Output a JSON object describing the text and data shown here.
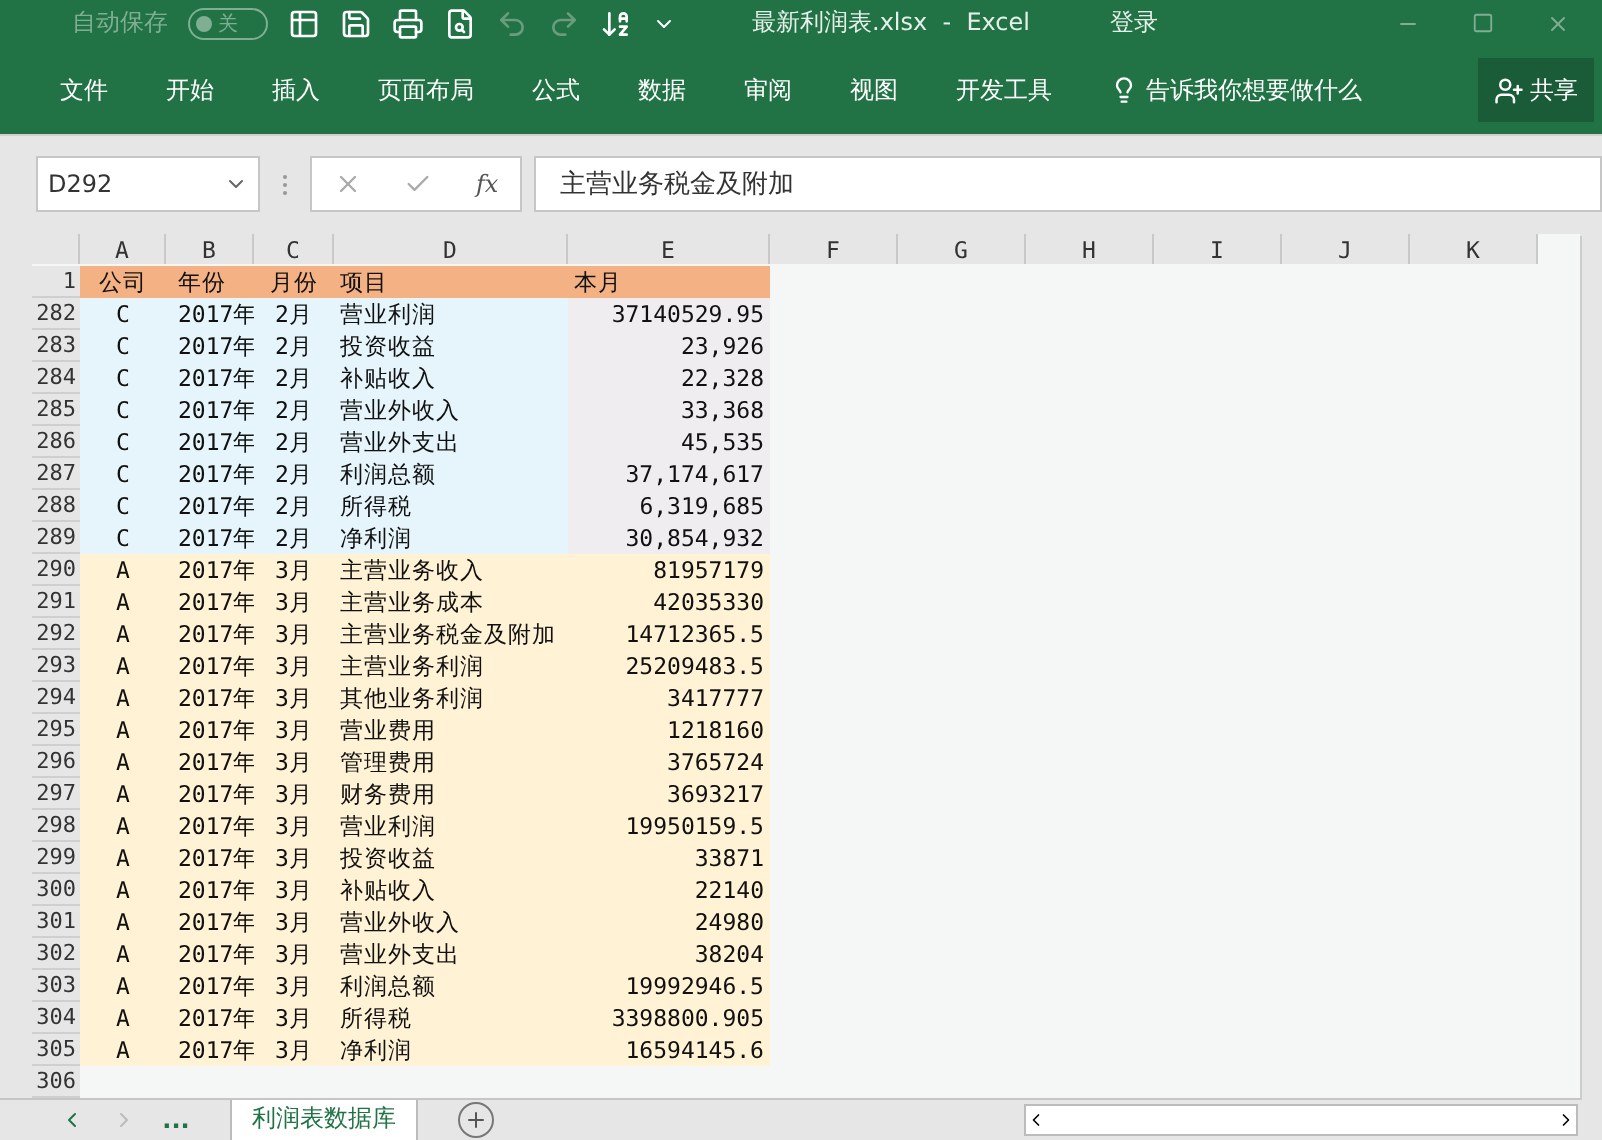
{
  "title_bar": {
    "autosave": {
      "label": "自动保存",
      "on": false,
      "state_text": "关"
    },
    "file_title": "最新利润表.xlsx  -  Excel",
    "sign_in": "登录"
  },
  "ribbon_tabs": [
    "文件",
    "开始",
    "插入",
    "页面布局",
    "公式",
    "数据",
    "审阅",
    "视图",
    "开发工具"
  ],
  "tell_me": "告诉我你想要做什么",
  "share": "共享",
  "formula_bar": {
    "name_box": "D292",
    "fx": "fx",
    "content": "主营业务税金及附加"
  },
  "columns": [
    "A",
    "B",
    "C",
    "D",
    "E",
    "F",
    "G",
    "H",
    "I",
    "J",
    "K"
  ],
  "header_row": {
    "number": "1",
    "cells": [
      "公司",
      "年份",
      "月份",
      "项目",
      "本月"
    ]
  },
  "rows": [
    {
      "number": "282",
      "kind": "blue",
      "cells": [
        "C",
        "2017年",
        "2月",
        "营业利润",
        "37140529.95"
      ]
    },
    {
      "number": "283",
      "kind": "blue",
      "cells": [
        "C",
        "2017年",
        "2月",
        "投资收益",
        "23,926"
      ]
    },
    {
      "number": "284",
      "kind": "blue",
      "cells": [
        "C",
        "2017年",
        "2月",
        "补贴收入",
        "22,328"
      ]
    },
    {
      "number": "285",
      "kind": "blue",
      "cells": [
        "C",
        "2017年",
        "2月",
        "营业外收入",
        "33,368"
      ]
    },
    {
      "number": "286",
      "kind": "blue",
      "cells": [
        "C",
        "2017年",
        "2月",
        "营业外支出",
        "45,535"
      ]
    },
    {
      "number": "287",
      "kind": "blue",
      "cells": [
        "C",
        "2017年",
        "2月",
        "利润总额",
        "37,174,617"
      ]
    },
    {
      "number": "288",
      "kind": "blue",
      "cells": [
        "C",
        "2017年",
        "2月",
        "所得税",
        "6,319,685"
      ]
    },
    {
      "number": "289",
      "kind": "blue",
      "cells": [
        "C",
        "2017年",
        "2月",
        "净利润",
        "30,854,932"
      ]
    },
    {
      "number": "290",
      "kind": "cream",
      "cells": [
        "A",
        "2017年",
        "3月",
        "主营业务收入",
        "81957179"
      ]
    },
    {
      "number": "291",
      "kind": "cream",
      "cells": [
        "A",
        "2017年",
        "3月",
        "主营业务成本",
        "42035330"
      ]
    },
    {
      "number": "292",
      "kind": "cream",
      "cells": [
        "A",
        "2017年",
        "3月",
        "主营业务税金及附加",
        "14712365.5"
      ]
    },
    {
      "number": "293",
      "kind": "cream",
      "cells": [
        "A",
        "2017年",
        "3月",
        "主营业务利润",
        "25209483.5"
      ]
    },
    {
      "number": "294",
      "kind": "cream",
      "cells": [
        "A",
        "2017年",
        "3月",
        "其他业务利润",
        "3417777"
      ]
    },
    {
      "number": "295",
      "kind": "cream",
      "cells": [
        "A",
        "2017年",
        "3月",
        "营业费用",
        "1218160"
      ]
    },
    {
      "number": "296",
      "kind": "cream",
      "cells": [
        "A",
        "2017年",
        "3月",
        "管理费用",
        "3765724"
      ]
    },
    {
      "number": "297",
      "kind": "cream",
      "cells": [
        "A",
        "2017年",
        "3月",
        "财务费用",
        "3693217"
      ]
    },
    {
      "number": "298",
      "kind": "cream",
      "cells": [
        "A",
        "2017年",
        "3月",
        "营业利润",
        "19950159.5"
      ]
    },
    {
      "number": "299",
      "kind": "cream",
      "cells": [
        "A",
        "2017年",
        "3月",
        "投资收益",
        "33871"
      ]
    },
    {
      "number": "300",
      "kind": "cream",
      "cells": [
        "A",
        "2017年",
        "3月",
        "补贴收入",
        "22140"
      ]
    },
    {
      "number": "301",
      "kind": "cream",
      "cells": [
        "A",
        "2017年",
        "3月",
        "营业外收入",
        "24980"
      ]
    },
    {
      "number": "302",
      "kind": "cream",
      "cells": [
        "A",
        "2017年",
        "3月",
        "营业外支出",
        "38204"
      ]
    },
    {
      "number": "303",
      "kind": "cream",
      "cells": [
        "A",
        "2017年",
        "3月",
        "利润总额",
        "19992946.5"
      ]
    },
    {
      "number": "304",
      "kind": "cream",
      "cells": [
        "A",
        "2017年",
        "3月",
        "所得税",
        "3398800.905"
      ]
    },
    {
      "number": "305",
      "kind": "cream",
      "cells": [
        "A",
        "2017年",
        "3月",
        "净利润",
        "16594145.6"
      ]
    },
    {
      "number": "306",
      "kind": "empty",
      "cells": []
    }
  ],
  "sheet_bar": {
    "more": "...",
    "tabs": [
      {
        "label": "利润表数据库",
        "selected": true
      }
    ]
  }
}
